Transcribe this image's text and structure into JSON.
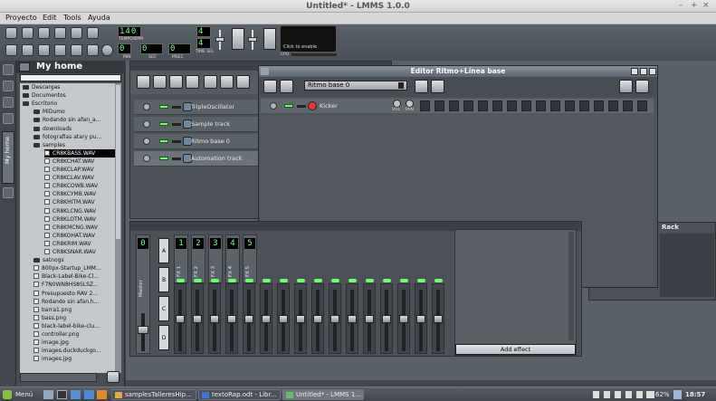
{
  "window": {
    "title": "Untitled* - LMMS 1.0.0"
  },
  "menubar": {
    "items": [
      "Proyecto",
      "Edit",
      "Tools",
      "Ayuda"
    ]
  },
  "toolbar": {
    "tempo_value": "140",
    "tempo_label": "TEMPO/BPM",
    "min_value": "0",
    "sec_value": "0",
    "msec_value": "0",
    "min_label": "MIN",
    "sec_label": "SEC",
    "msec_label": "MSEC",
    "time_sig_top": "4",
    "time_sig_bottom": "4",
    "time_sig_label": "TIME SIG",
    "cpu_text": "Click to enable",
    "cpu_label": "CPU"
  },
  "browser": {
    "title": "My home",
    "side_tab": "My home",
    "items": [
      {
        "label": "Descargas",
        "type": "folder"
      },
      {
        "label": "Documentos",
        "type": "folder"
      },
      {
        "label": "Escritorio",
        "type": "folder"
      },
      {
        "label": "MiDumo",
        "type": "folder"
      },
      {
        "label": "Rodando sin afan_a...",
        "type": "folder"
      },
      {
        "label": "downloads",
        "type": "folder"
      },
      {
        "label": "fotografias atary pu...",
        "type": "folder"
      },
      {
        "label": "samples",
        "type": "folder"
      },
      {
        "label": "CR8KBASS.WAV",
        "type": "file",
        "selected": true
      },
      {
        "label": "CR8KCHAT.WAV",
        "type": "file"
      },
      {
        "label": "CR8KCLAP.WAV",
        "type": "file"
      },
      {
        "label": "CR8KCLAV.WAV",
        "type": "file"
      },
      {
        "label": "CR8KCOWB.WAV",
        "type": "file"
      },
      {
        "label": "CR8KCYMB.WAV",
        "type": "file"
      },
      {
        "label": "CR8KHITM.WAV",
        "type": "file"
      },
      {
        "label": "CR8KLCNG.WAV",
        "type": "file"
      },
      {
        "label": "CR8KLOTM.WAV",
        "type": "file"
      },
      {
        "label": "CR8KMCNG.WAV",
        "type": "file"
      },
      {
        "label": "CR8KOHAT.WAV",
        "type": "file"
      },
      {
        "label": "CR8KRIM.WAV",
        "type": "file"
      },
      {
        "label": "CR8KSNAR.WAV",
        "type": "file"
      },
      {
        "label": "satnogs",
        "type": "folder"
      },
      {
        "label": "800px-Startup_LMM...",
        "type": "file"
      },
      {
        "label": "Black-Label-Bike-Cl...",
        "type": "file"
      },
      {
        "label": "F7N0WN8HS8SLSZ...",
        "type": "file"
      },
      {
        "label": "Presupuesto RAV 2...",
        "type": "file"
      },
      {
        "label": "Rodando sin afan.h...",
        "type": "file"
      },
      {
        "label": "barra1.png",
        "type": "file"
      },
      {
        "label": "bass.png",
        "type": "file"
      },
      {
        "label": "black-label-bike-clu...",
        "type": "file"
      },
      {
        "label": "controller.png",
        "type": "file"
      },
      {
        "label": "image.jpg",
        "type": "file"
      },
      {
        "label": "images.duckduckgo...",
        "type": "file"
      },
      {
        "label": "images.jpg",
        "type": "file"
      }
    ]
  },
  "song_editor": {
    "tracks": [
      {
        "name": "TripleOscillator"
      },
      {
        "name": "Sample track"
      },
      {
        "name": "Ritmo base 0"
      },
      {
        "name": "Automation track",
        "selected": true
      }
    ]
  },
  "beat_editor": {
    "title": "Editor Ritmo+Línea base",
    "pattern": "Ritmo base 0",
    "instrument": "Kicker",
    "vol_label": "VOL",
    "pan_label": "PAN",
    "steps": 16
  },
  "mixer": {
    "master_num": "0",
    "master_label": "Master",
    "channels": [
      {
        "num": "1",
        "label": "FX 1"
      },
      {
        "num": "2",
        "label": "FX 2"
      },
      {
        "num": "3",
        "label": "FX 3"
      },
      {
        "num": "4",
        "label": "FX 4"
      },
      {
        "num": "5",
        "label": "FX 5"
      }
    ],
    "group_buttons": [
      "A",
      "B",
      "C",
      "D"
    ],
    "add_effect_label": "Add effect"
  },
  "controller_rack": {
    "title": "Rack"
  },
  "taskbar": {
    "menu_label": "Menú",
    "windows": [
      "samplesTalleresHip...",
      "textoRap.odt - Libr...",
      "Untitled* - LMMS 1..."
    ],
    "battery": "62%",
    "clock": "18:57"
  },
  "colors": {
    "accent_led": "#6cff6c",
    "lcd_text": "#7dff9a",
    "selection": "#000000"
  }
}
